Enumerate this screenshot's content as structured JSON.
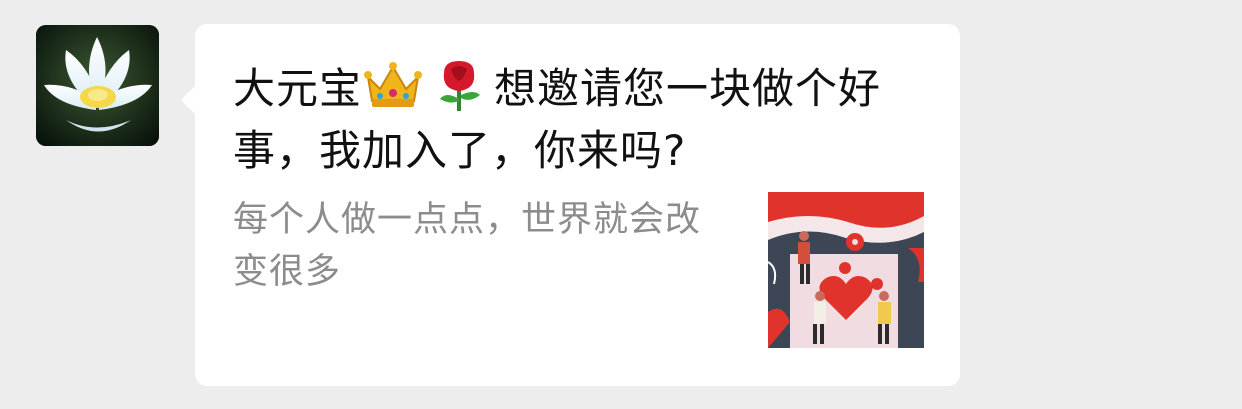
{
  "chat": {
    "sender_avatar": {
      "image": "lotus-flower"
    },
    "message": {
      "title_part1": "大元宝",
      "crown_emoji": "👑",
      "rose_emoji": "🌹",
      "title_part2": "想邀请您一块做个好事，我加入了，你来吗?",
      "description": "每个人做一点点，世界就会改变很多",
      "thumbnail": {
        "image": "charity-heart-illustration"
      }
    }
  },
  "colors": {
    "background": "#ededed",
    "bubble": "#ffffff",
    "title_text": "#111111",
    "description_text": "#8c8c8c",
    "accent_red": "#e0332c"
  }
}
